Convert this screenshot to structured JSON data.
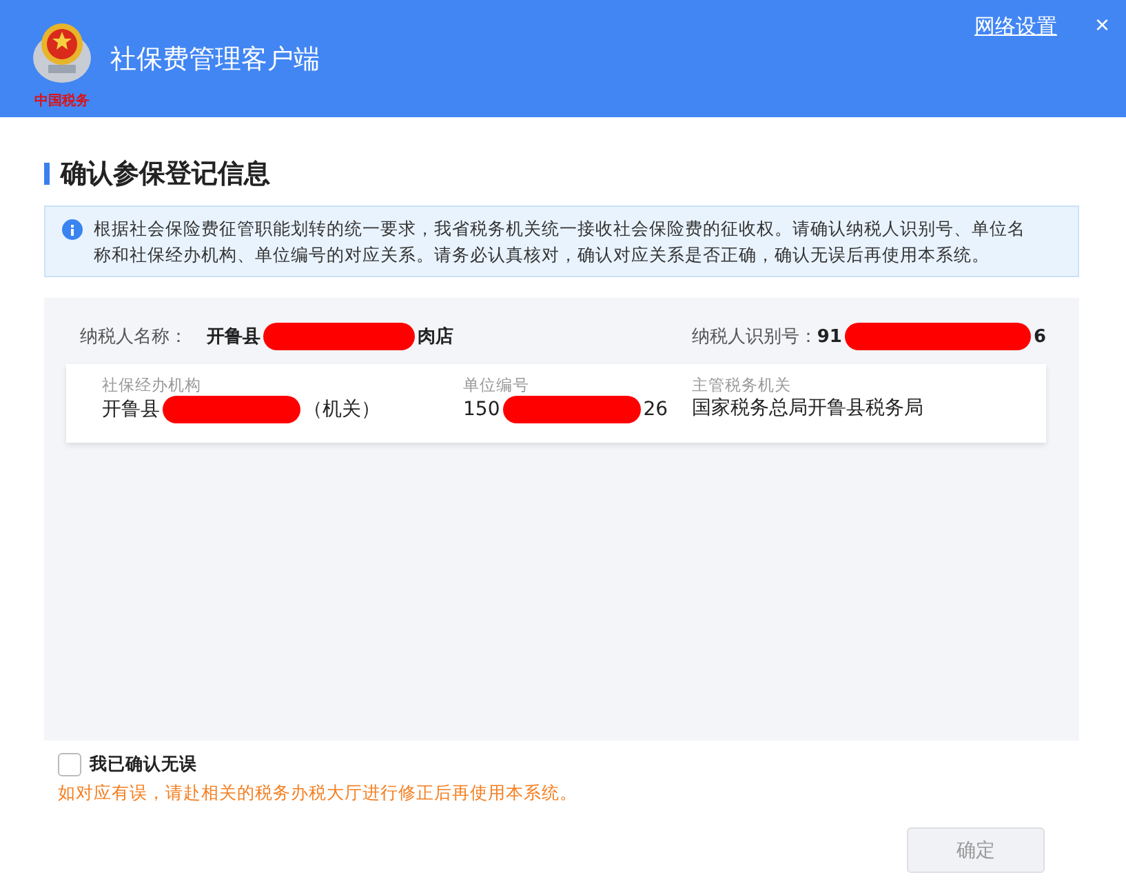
{
  "header": {
    "logo_text": "中国税务",
    "title": "社保费管理客户端",
    "network_link": "网络设置",
    "close": "×"
  },
  "heading": "确认参保登记信息",
  "notice": "根据社会保险费征管职能划转的统一要求，我省税务机关统一接收社会保险费的征收权。请确认纳税人识别号、单位名称和社保经办机构、单位编号的对应关系。请务必认真核对，确认对应关系是否正确，确认无误后再使用本系统。",
  "taxpayer": {
    "name_label": "纳税人名称：",
    "name": {
      "start": "开鲁县",
      "end": "肉店",
      "redacted": true
    },
    "id_label": "纳税人识别号：",
    "id": {
      "start": "91",
      "end": "6",
      "redacted": true
    }
  },
  "card": [
    {
      "label": "社保经办机构",
      "value": {
        "start": "开鲁县",
        "end": "（机关）",
        "redacted": true
      }
    },
    {
      "label": "单位编号",
      "value": {
        "start": "150",
        "end": "26",
        "redacted": true
      }
    },
    {
      "label": "主管税务机关",
      "value": {
        "start": "国家税务总局开鲁县税务局",
        "redacted": false
      }
    }
  ],
  "confirm": {
    "label": "我已确认无误",
    "checked": false
  },
  "warning": "如对应有误，请赴相关的税务办税大厅进行修正后再使用本系统。",
  "ok_button": {
    "label": "确定",
    "disabled": true
  }
}
